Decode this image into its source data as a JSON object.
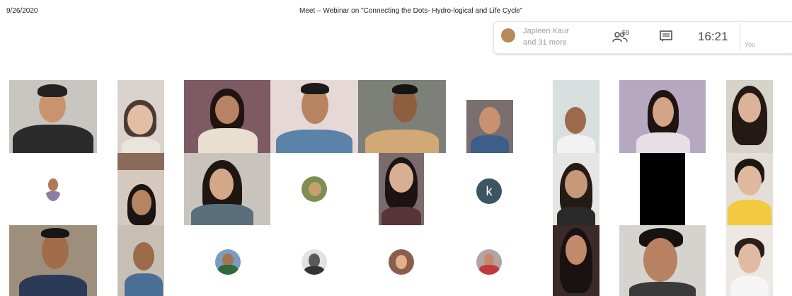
{
  "header": {
    "date": "9/26/2020",
    "title": "Meet – Webinar on \"Connecting the Dots- Hydro-logical and Life Cycle\""
  },
  "panel": {
    "presenter_name": "Japleen Kaur",
    "presenter_more": "and 31 more",
    "people_count": "59",
    "time": "16:21",
    "self_label": "You"
  },
  "tiles": {
    "k_initial": "k"
  },
  "colors": {
    "avatar_bg": "#3c5563",
    "panel_bg": "#ffffff"
  }
}
